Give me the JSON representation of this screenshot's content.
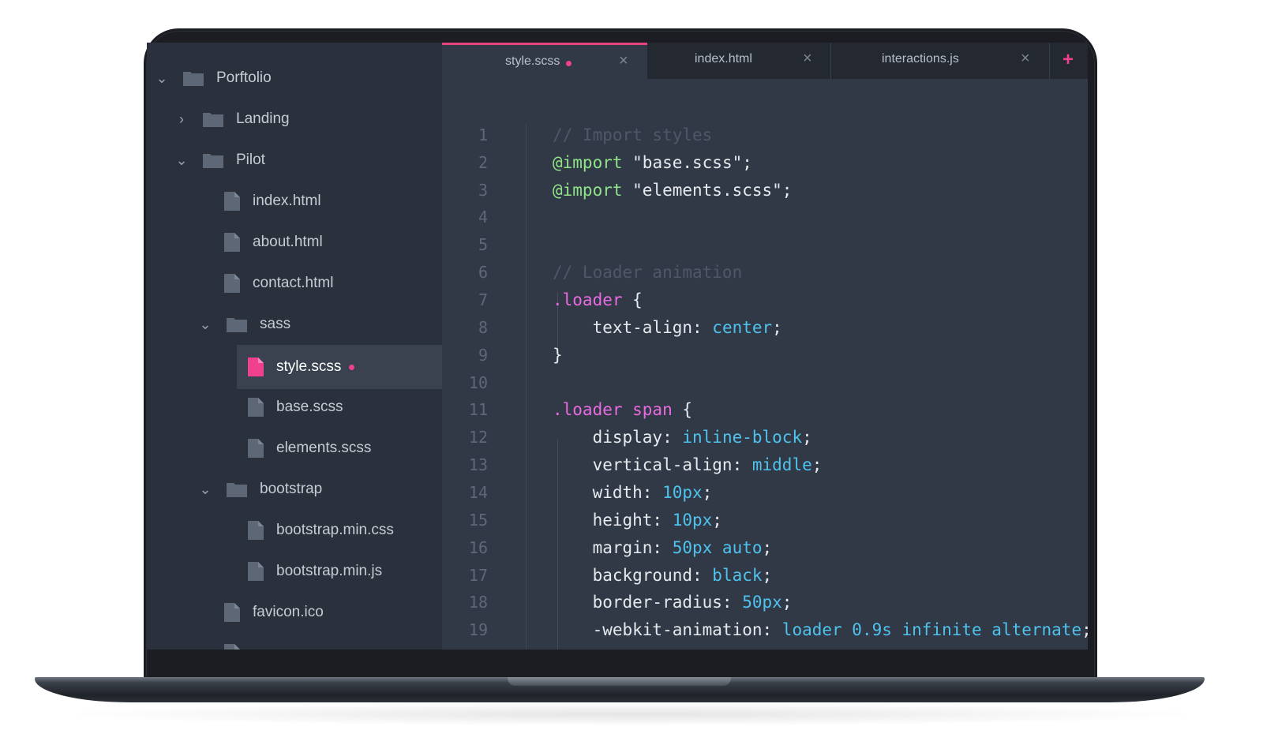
{
  "colors": {
    "accent": "#f0418f",
    "sidebar_bg": "#2b313c",
    "editor_bg": "#323946",
    "tab_bar_bg": "#232831"
  },
  "sidebar": {
    "items": [
      {
        "label": "Porftolio",
        "kind": "folder",
        "expanded": true
      },
      {
        "label": "Landing",
        "kind": "folder",
        "expanded": false
      },
      {
        "label": "Pilot",
        "kind": "folder",
        "expanded": true
      },
      {
        "label": "index.html",
        "kind": "file"
      },
      {
        "label": "about.html",
        "kind": "file"
      },
      {
        "label": "contact.html",
        "kind": "file"
      },
      {
        "label": "sass",
        "kind": "folder",
        "expanded": true
      },
      {
        "label": "style.scss",
        "kind": "file",
        "selected": true,
        "modified": true
      },
      {
        "label": "base.scss",
        "kind": "file"
      },
      {
        "label": "elements.scss",
        "kind": "file"
      },
      {
        "label": "bootstrap",
        "kind": "folder",
        "expanded": true
      },
      {
        "label": "bootstrap.min.css",
        "kind": "file"
      },
      {
        "label": "bootstrap.min.js",
        "kind": "file"
      },
      {
        "label": "favicon.ico",
        "kind": "file"
      }
    ]
  },
  "tabs": [
    {
      "label": "style.scss",
      "active": true,
      "modified": true,
      "close": "×"
    },
    {
      "label": "index.html",
      "active": false,
      "close": "×"
    },
    {
      "label": "interactions.js",
      "active": false,
      "close": "×"
    }
  ],
  "tab_add_label": "+",
  "editor": {
    "lines": [
      {
        "n": "1",
        "text": "// Import styles"
      },
      {
        "n": "2",
        "at": "@import",
        "rest": " \"base.scss\";"
      },
      {
        "n": "3",
        "at": "@import",
        "rest": " \"elements.scss\";"
      },
      {
        "n": "4"
      },
      {
        "n": "5"
      },
      {
        "n": "6",
        "text": "// Loader animation"
      },
      {
        "n": "7",
        "sel": ".loader",
        "rest": " {"
      },
      {
        "n": "8",
        "prop": "    text-align: ",
        "val": "center",
        "end": ";"
      },
      {
        "n": "9",
        "rest": "}"
      },
      {
        "n": "10"
      },
      {
        "n": "11",
        "sel": ".loader span",
        "rest": " {"
      },
      {
        "n": "12",
        "prop": "    display: ",
        "val": "inline-block",
        "end": ";"
      },
      {
        "n": "13",
        "prop": "    vertical-align: ",
        "val": "middle",
        "end": ";"
      },
      {
        "n": "14",
        "prop": "    width: ",
        "val": "10px",
        "end": ";"
      },
      {
        "n": "15",
        "prop": "    height: ",
        "val": "10px",
        "end": ";"
      },
      {
        "n": "16",
        "prop": "    margin: ",
        "val": "50px auto",
        "end": ";"
      },
      {
        "n": "17",
        "prop": "    background: ",
        "val": "black",
        "end": ";"
      },
      {
        "n": "18",
        "prop": "    border-radius: ",
        "val": "50px",
        "end": ";"
      },
      {
        "n": "19",
        "prop": "    -webkit-animation: ",
        "val": "loader 0.9s infinite alternate",
        "end": ";"
      }
    ]
  }
}
